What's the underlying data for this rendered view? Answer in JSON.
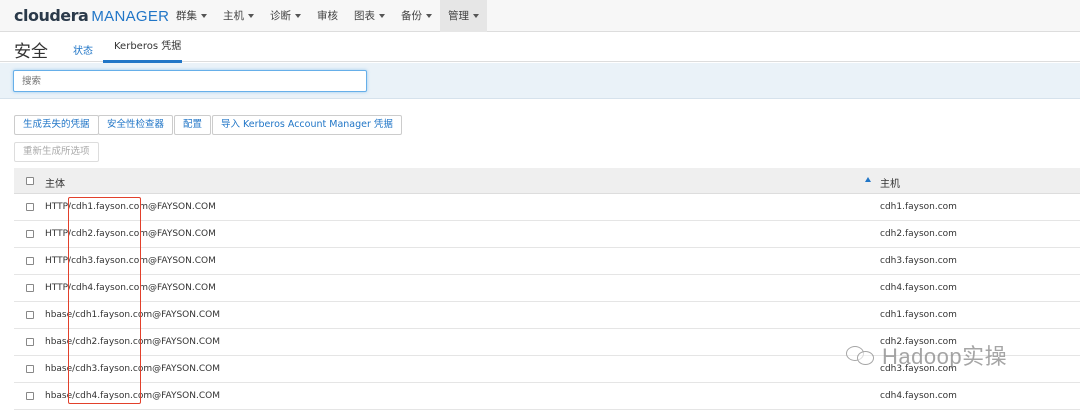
{
  "app": {
    "logo_part1": "cloudera",
    "logo_part2": "MANAGER"
  },
  "topnav": {
    "items": [
      {
        "label": "群集",
        "dropdown": true,
        "active": false
      },
      {
        "label": "主机",
        "dropdown": true,
        "active": false
      },
      {
        "label": "诊断",
        "dropdown": true,
        "active": false
      },
      {
        "label": "审核",
        "dropdown": false,
        "active": false
      },
      {
        "label": "图表",
        "dropdown": true,
        "active": false
      },
      {
        "label": "备份",
        "dropdown": true,
        "active": false
      },
      {
        "label": "管理",
        "dropdown": true,
        "active": true
      }
    ]
  },
  "page": {
    "title": "安全",
    "tabs": [
      {
        "label": "状态"
      },
      {
        "label": "Kerberos 凭据"
      }
    ]
  },
  "search": {
    "placeholder": "搜索"
  },
  "actions": {
    "generate_missing": "生成丢失的凭据",
    "security_inspector": "安全性检查器",
    "configure": "配置",
    "import": "导入 Kerberos Account Manager 凭据",
    "regenerate_selected": "重新生成所选项"
  },
  "table": {
    "columns": {
      "principal": "主体",
      "host": "主机"
    },
    "rows": [
      {
        "principal": "HTTP/cdh1.fayson.com@FAYSON.COM",
        "host": "cdh1.fayson.com"
      },
      {
        "principal": "HTTP/cdh2.fayson.com@FAYSON.COM",
        "host": "cdh2.fayson.com"
      },
      {
        "principal": "HTTP/cdh3.fayson.com@FAYSON.COM",
        "host": "cdh3.fayson.com"
      },
      {
        "principal": "HTTP/cdh4.fayson.com@FAYSON.COM",
        "host": "cdh4.fayson.com"
      },
      {
        "principal": "hbase/cdh1.fayson.com@FAYSON.COM",
        "host": "cdh1.fayson.com"
      },
      {
        "principal": "hbase/cdh2.fayson.com@FAYSON.COM",
        "host": "cdh2.fayson.com"
      },
      {
        "principal": "hbase/cdh3.fayson.com@FAYSON.COM",
        "host": "cdh3.fayson.com"
      },
      {
        "principal": "hbase/cdh4.fayson.com@FAYSON.COM",
        "host": "cdh4.fayson.com"
      }
    ]
  },
  "watermark": {
    "text": "Hadoop实操"
  },
  "colors": {
    "accent": "#2176c7",
    "highlight": "#e2402b"
  }
}
